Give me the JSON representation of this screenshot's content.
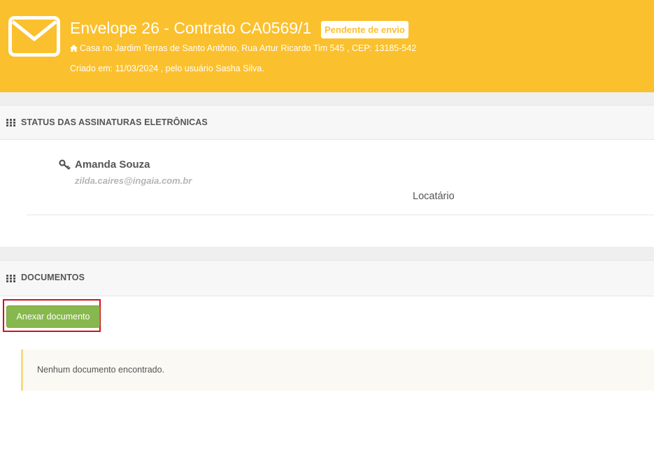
{
  "header": {
    "title": "Envelope 26 - Contrato CA0569/1",
    "status_badge": "Pendente de envio",
    "address": "Casa no Jardim Terras de Santo Antônio, Rua Artur Ricardo Tim 545 , CEP: 13185-542",
    "created": "Criado em: 11/03/2024 , pelo usuário Sasha Silva.",
    "icons": [
      "envelope-icon",
      "home-icon"
    ],
    "colors": {
      "accent": "#fbc02d",
      "badge_bg": "#ffffff"
    }
  },
  "signatures_section": {
    "title": "STATUS DAS ASSINATURAS ELETRÔNICAS",
    "icon": "grid-icon",
    "signers": [
      {
        "name": "Amanda Souza",
        "email": "zilda.caires@ingaia.com.br",
        "role": "Locatário",
        "icon": "key-icon"
      }
    ]
  },
  "documents_section": {
    "title": "DOCUMENTOS",
    "icon": "grid-icon",
    "attach_button": "Anexar documento",
    "empty_message": "Nenhum documento encontrado.",
    "colors": {
      "button": "#87b84d",
      "highlight_border": "#d0121b",
      "alert_border": "#f5d98a"
    }
  }
}
